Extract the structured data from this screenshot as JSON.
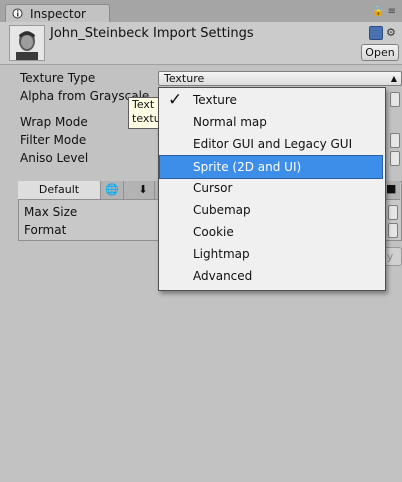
{
  "window": {
    "tab_label": "Inspector",
    "icons": [
      "inspector-icon",
      "lock-icon",
      "menu-icon"
    ]
  },
  "header": {
    "title": "John_Steinbeck Import Settings",
    "open_label": "Open",
    "icons": [
      "help-icon",
      "gear-icon"
    ]
  },
  "properties": [
    {
      "label": "Texture Type",
      "value": "Texture"
    },
    {
      "label": "Alpha from Grayscale"
    },
    {
      "label": "Wrap Mode"
    },
    {
      "label": "Filter Mode"
    },
    {
      "label": "Aniso Level"
    }
  ],
  "tooltip": {
    "lines": [
      "Text",
      "textu"
    ]
  },
  "platform": {
    "tabs": [
      {
        "label": "Default"
      },
      {
        "icon": "globe-icon"
      },
      {
        "icon": "download-icon"
      }
    ],
    "rows": [
      {
        "label": "Max Size"
      },
      {
        "label": "Format"
      }
    ],
    "apply_label": "y"
  },
  "menu": {
    "items": [
      {
        "label": "Texture",
        "checked": true
      },
      {
        "label": "Normal map"
      },
      {
        "label": "Editor GUI and Legacy GUI"
      },
      {
        "label": "Sprite (2D and UI)",
        "highlighted": true
      },
      {
        "label": "Cursor"
      },
      {
        "label": "Cubemap"
      },
      {
        "label": "Cookie"
      },
      {
        "label": "Lightmap"
      },
      {
        "label": "Advanced"
      }
    ],
    "highlight_color": "#3d8ee8"
  }
}
